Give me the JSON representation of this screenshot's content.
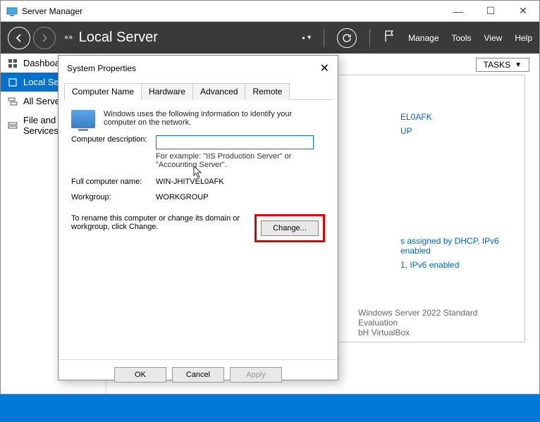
{
  "window": {
    "title": "Server Manager"
  },
  "header": {
    "title": "Local Server",
    "manage": "Manage",
    "tools": "Tools",
    "view": "View",
    "help": "Help"
  },
  "sidebar": {
    "items": [
      {
        "label": "Dashboard"
      },
      {
        "label": "Local Server"
      },
      {
        "label": "All Servers"
      },
      {
        "label": "File and Storage Services"
      }
    ]
  },
  "panel": {
    "tasks": "TASKS",
    "comp_name_val": "EL0AFK",
    "workgroup_val": "UP",
    "ipv4_line": "s assigned by DHCP, IPv6 enabled",
    "ipv4_line2": "1, IPv6 enabled",
    "os_line": "Windows Server 2022 Standard Evaluation",
    "hw_line": "bH VirtualBox"
  },
  "dialog": {
    "title": "System Properties",
    "tabs": {
      "computer_name": "Computer Name",
      "hardware": "Hardware",
      "advanced": "Advanced",
      "remote": "Remote"
    },
    "intro": "Windows uses the following information to identify your computer on the network.",
    "labels": {
      "description": "Computer description:",
      "full_name": "Full computer name:",
      "workgroup": "Workgroup:"
    },
    "values": {
      "description": "",
      "hint": "For example: \"IIS Production Server\" or \"Accounting Server\".",
      "full_name": "WIN-JHITVEL0AFK",
      "workgroup": "WORKGROUP"
    },
    "change_text": "To rename this computer or change its domain or workgroup, click Change.",
    "change_btn": "Change...",
    "footer": {
      "ok": "OK",
      "cancel": "Cancel",
      "apply": "Apply"
    }
  }
}
